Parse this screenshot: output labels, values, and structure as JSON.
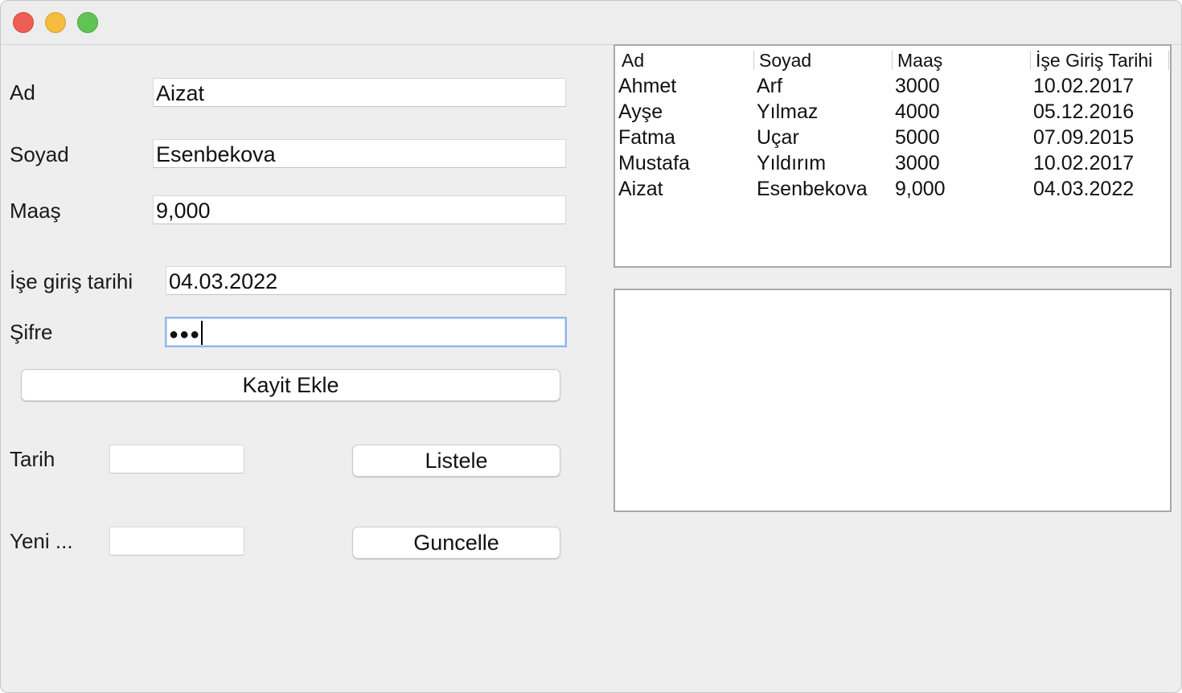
{
  "form": {
    "ad_label": "Ad",
    "ad_value": "Aizat",
    "soyad_label": "Soyad",
    "soyad_value": "Esenbekova",
    "maas_label": "Maaş",
    "maas_value": "9,000",
    "tarih_label": "İşe giriş tarihi",
    "tarih_value": "04.03.2022",
    "sifre_label": "Şifre",
    "sifre_value": "●●●",
    "add_button": "Kayit Ekle"
  },
  "filter": {
    "tarih_label": "Tarih",
    "tarih_value": "",
    "list_button": "Listele",
    "yeni_label": "Yeni ...",
    "yeni_value": "",
    "update_button": "Guncelle"
  },
  "table": {
    "columns": [
      "Ad",
      "Soyad",
      "Maaş",
      "İşe Giriş Tarihi"
    ],
    "rows": [
      [
        "Ahmet",
        "Arf",
        "3000",
        "10.02.2017"
      ],
      [
        "Ayşe",
        "Yılmaz",
        "4000",
        "05.12.2016"
      ],
      [
        "Fatma",
        "Uçar",
        "5000",
        "07.09.2015"
      ],
      [
        "Mustafa",
        "Yıldırım",
        "3000",
        "10.02.2017"
      ],
      [
        "Aizat",
        "Esenbekova",
        "9,000",
        "04.03.2022"
      ]
    ]
  },
  "output_area": {
    "text": ""
  },
  "colors": {
    "window_bg": "#eeeeee",
    "close": "#ee5d56",
    "minimize": "#f5bd3f",
    "maximize": "#5fc454",
    "focus_ring": "#8fb7ea"
  }
}
